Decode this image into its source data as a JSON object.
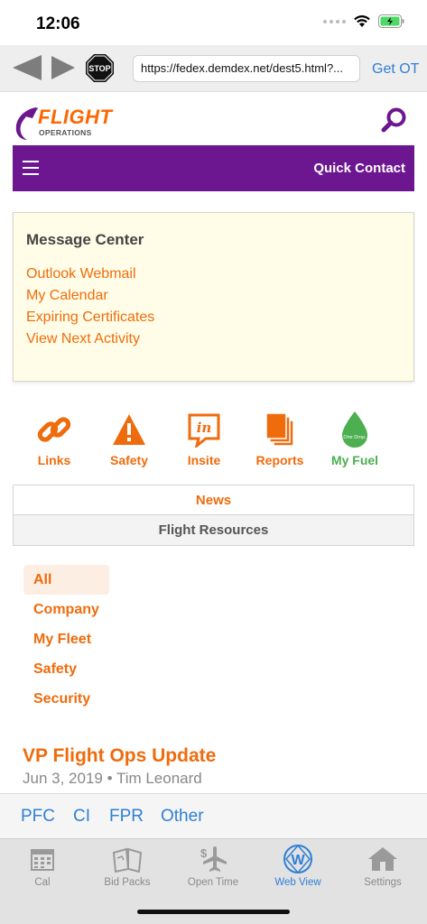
{
  "status_bar": {
    "time": "12:06"
  },
  "browser": {
    "url": "https://fedex.demdex.net/dest5.html?...",
    "stop_label": "STOP",
    "get_ot_label": "Get OT"
  },
  "header": {
    "logo_title": "FLIGHT",
    "logo_subtitle": "OPERATIONS"
  },
  "nav": {
    "quick_contact_label": "Quick Contact"
  },
  "message_center": {
    "title": "Message Center",
    "links": [
      "Outlook Webmail",
      "My Calendar",
      "Expiring Certificates",
      "View Next Activity"
    ]
  },
  "quick_links": [
    {
      "label": "Links",
      "icon": "link-icon"
    },
    {
      "label": "Safety",
      "icon": "warning-icon"
    },
    {
      "label": "Insite",
      "icon": "insite-icon"
    },
    {
      "label": "Reports",
      "icon": "reports-icon"
    },
    {
      "label": "My Fuel",
      "icon": "fuel-drop-icon",
      "icon_text": "One Drop."
    }
  ],
  "content_tabs": {
    "news": "News",
    "flight_resources": "Flight Resources"
  },
  "filters": [
    "All",
    "Company",
    "My Fleet",
    "Safety",
    "Security"
  ],
  "article": {
    "title": "VP Flight Ops Update",
    "meta": "Jun 3, 2019 • Tim Leonard"
  },
  "link_bar": [
    "PFC",
    "CI",
    "FPR",
    "Other"
  ],
  "tab_bar": [
    {
      "label": "Cal",
      "icon": "calendar-icon"
    },
    {
      "label": "Bid Packs",
      "icon": "bid-packs-icon"
    },
    {
      "label": "Open Time",
      "icon": "open-time-icon"
    },
    {
      "label": "Web View",
      "icon": "web-view-icon"
    },
    {
      "label": "Settings",
      "icon": "settings-house-icon"
    }
  ],
  "colors": {
    "brand_orange": "#ef6c0d",
    "brand_purple": "#6c1690",
    "link_blue": "#2f7fd6",
    "fuel_green": "#4caf50"
  }
}
